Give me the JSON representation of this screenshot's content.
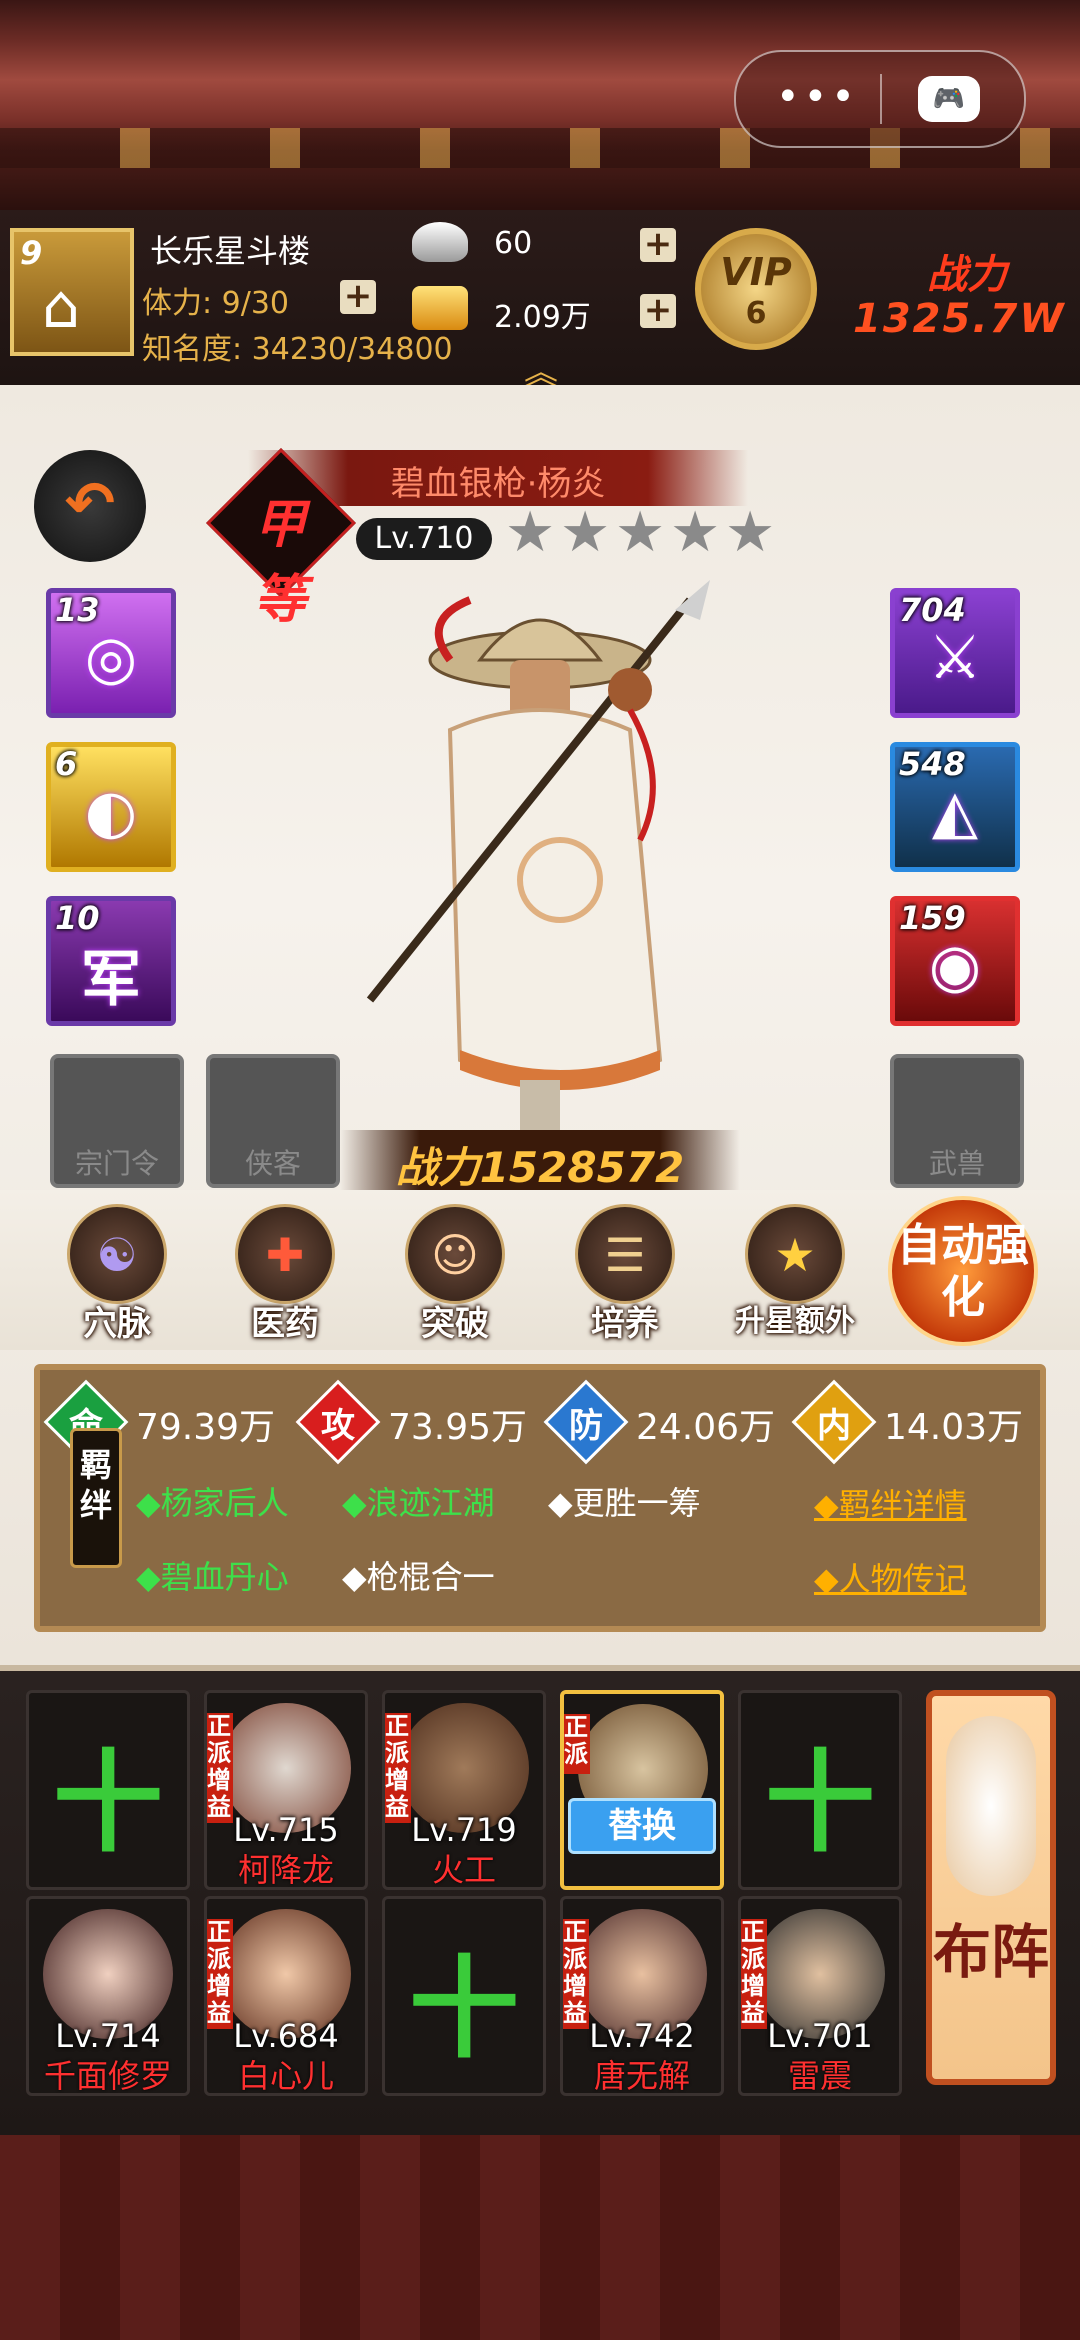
{
  "top": {
    "capsule_dots": "•••",
    "gamepad_icon": "gamepad-icon"
  },
  "player": {
    "avatar_level": "9",
    "name": "长乐星斗楼",
    "stamina_label": "体力: 9/30",
    "fame_label": "知名度: 34230/34800",
    "silver": "60",
    "gold": "2.09万",
    "vip_text": "VIP",
    "vip_level": "6",
    "power_label": "战力",
    "power_value": "1325.7W",
    "expand_chevron": "︽"
  },
  "hero": {
    "grade": "甲等",
    "name": "碧血银枪·杨炎",
    "level": "Lv.710",
    "stars": [
      "★",
      "★",
      "★",
      "★",
      "★"
    ],
    "battle_power": "战力1528572",
    "back_glyph": "↶"
  },
  "skills_left": [
    {
      "num": "13",
      "glyph": "◎",
      "color": "#b040d8"
    },
    {
      "num": "6",
      "glyph": "◐",
      "color": "#e0a814"
    },
    {
      "num": "10",
      "glyph": "军",
      "color": "#6a2a8a"
    }
  ],
  "equip_right": [
    {
      "num": "704",
      "glyph": "⚔",
      "color": "#7a3ac0"
    },
    {
      "num": "548",
      "glyph": "◭",
      "color": "#2a5a9a"
    },
    {
      "num": "159",
      "glyph": "◉",
      "color": "#c82020"
    }
  ],
  "empty_slots": {
    "sect": "宗门令",
    "guest": "侠客",
    "beast": "武兽"
  },
  "functions": [
    {
      "label": "穴脉",
      "icon": "☯"
    },
    {
      "label": "医药",
      "icon": "✚"
    },
    {
      "label": "突破",
      "icon": "☺"
    },
    {
      "label": "培养",
      "icon": "☰"
    },
    {
      "label": "升星额外",
      "icon": "★"
    }
  ],
  "auto_enhance": "自动强化",
  "stats": {
    "hp_icon": "命",
    "hp": "79.39万",
    "atk_icon": "攻",
    "atk": "73.95万",
    "def_icon": "防",
    "def": "24.06万",
    "inner_icon": "内",
    "inner": "14.03万",
    "bond_label": "羁绊",
    "bond_row1": [
      "◆杨家后人",
      "◆浪迹江湖",
      "◆更胜一筹"
    ],
    "bond_row2": [
      "◆碧血丹心",
      "◆枪棍合一"
    ],
    "bond_details": "◆羁绊详情",
    "biography": "◆人物传记",
    "colors": {
      "hp": "#1aa040",
      "atk": "#d81e1e",
      "def": "#2a78d0",
      "inner": "#e0a010"
    }
  },
  "lineup": {
    "row1": [
      {
        "empty": true,
        "plus": "十"
      },
      {
        "tag": "正派增益",
        "level": "Lv.715",
        "name": "柯降龙"
      },
      {
        "tag": "正派增益",
        "level": "Lv.719",
        "name": "火工"
      },
      {
        "tag": "正派",
        "selected": true,
        "action": "替换"
      },
      {
        "empty": true,
        "plus": "十"
      }
    ],
    "row2": [
      {
        "level": "Lv.714",
        "name": "千面修罗"
      },
      {
        "tag": "正派增益",
        "level": "Lv.684",
        "name": "白心儿"
      },
      {
        "empty": true,
        "plus": "十"
      },
      {
        "tag": "正派增益",
        "level": "Lv.742",
        "name": "唐无解"
      },
      {
        "tag": "正派增益",
        "level": "Lv.701",
        "name": "雷震"
      }
    ],
    "formation": "布阵"
  }
}
